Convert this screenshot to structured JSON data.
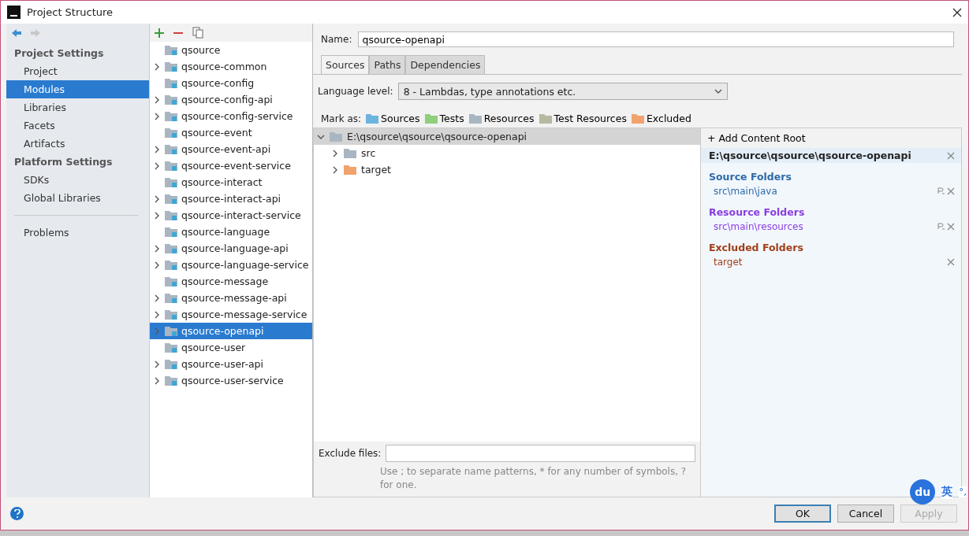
{
  "window": {
    "title": "Project Structure"
  },
  "nav": {
    "sections": [
      {
        "title": "Project Settings",
        "items": [
          {
            "label": "Project",
            "selected": false
          },
          {
            "label": "Modules",
            "selected": true
          },
          {
            "label": "Libraries",
            "selected": false
          },
          {
            "label": "Facets",
            "selected": false
          },
          {
            "label": "Artifacts",
            "selected": false
          }
        ]
      },
      {
        "title": "Platform Settings",
        "items": [
          {
            "label": "SDKs",
            "selected": false
          },
          {
            "label": "Global Libraries",
            "selected": false
          }
        ]
      }
    ],
    "extra": [
      {
        "label": "Problems",
        "selected": false
      }
    ]
  },
  "modules": [
    {
      "name": "qsource",
      "expandable": false,
      "selected": false
    },
    {
      "name": "qsource-common",
      "expandable": true,
      "selected": false
    },
    {
      "name": "qsource-config",
      "expandable": false,
      "selected": false
    },
    {
      "name": "qsource-config-api",
      "expandable": true,
      "selected": false
    },
    {
      "name": "qsource-config-service",
      "expandable": true,
      "selected": false
    },
    {
      "name": "qsource-event",
      "expandable": false,
      "selected": false
    },
    {
      "name": "qsource-event-api",
      "expandable": true,
      "selected": false
    },
    {
      "name": "qsource-event-service",
      "expandable": true,
      "selected": false
    },
    {
      "name": "qsource-interact",
      "expandable": false,
      "selected": false
    },
    {
      "name": "qsource-interact-api",
      "expandable": true,
      "selected": false
    },
    {
      "name": "qsource-interact-service",
      "expandable": true,
      "selected": false
    },
    {
      "name": "qsource-language",
      "expandable": false,
      "selected": false
    },
    {
      "name": "qsource-language-api",
      "expandable": true,
      "selected": false
    },
    {
      "name": "qsource-language-service",
      "expandable": true,
      "selected": false
    },
    {
      "name": "qsource-message",
      "expandable": false,
      "selected": false
    },
    {
      "name": "qsource-message-api",
      "expandable": true,
      "selected": false
    },
    {
      "name": "qsource-message-service",
      "expandable": true,
      "selected": false
    },
    {
      "name": "qsource-openapi",
      "expandable": true,
      "selected": true
    },
    {
      "name": "qsource-user",
      "expandable": false,
      "selected": false
    },
    {
      "name": "qsource-user-api",
      "expandable": true,
      "selected": false
    },
    {
      "name": "qsource-user-service",
      "expandable": true,
      "selected": false
    }
  ],
  "name_field": {
    "label": "Name:",
    "value": "qsource-openapi"
  },
  "tabs": [
    {
      "label": "Sources",
      "selected": true
    },
    {
      "label": "Paths",
      "selected": false
    },
    {
      "label": "Dependencies",
      "selected": false
    }
  ],
  "language_level": {
    "label": "Language level:",
    "value": "8 - Lambdas, type annotations etc."
  },
  "mark_as": {
    "label": "Mark as:",
    "options": [
      {
        "label": "Sources",
        "color": "#6cb4de"
      },
      {
        "label": "Tests",
        "color": "#8fcf7b"
      },
      {
        "label": "Resources",
        "color": "#a9b6c2"
      },
      {
        "label": "Test Resources",
        "color": "#b8b8a0"
      },
      {
        "label": "Excluded",
        "color": "#f0a36c"
      }
    ]
  },
  "tree": {
    "label": "E:\\qsource\\qsource\\qsource-openapi",
    "expanded": true,
    "children": [
      {
        "label": "src",
        "expanded": false,
        "color": "#a9b6c2"
      },
      {
        "label": "target",
        "expanded": false,
        "color": "#f0a36c"
      }
    ]
  },
  "exclude_files": {
    "label": "Exclude files:",
    "hint": "Use ; to separate name patterns, * for any number of symbols, ? for one."
  },
  "content_root": {
    "add_label": "+ Add Content Root",
    "path": "E:\\qsource\\qsource\\qsource-openapi",
    "groups": [
      {
        "title": "Source Folders",
        "color": "#2d6aa8",
        "folders": [
          {
            "path": "src\\main\\java",
            "properties": true
          }
        ]
      },
      {
        "title": "Resource Folders",
        "color": "#8a3ee0",
        "folders": [
          {
            "path": "src\\main\\resources",
            "properties": true
          }
        ]
      },
      {
        "title": "Excluded Folders",
        "color": "#a0401a",
        "folders": [
          {
            "path": "target",
            "properties": false
          }
        ]
      }
    ]
  },
  "buttons": [
    {
      "label": "OK",
      "disabled": false,
      "default": true
    },
    {
      "label": "Cancel",
      "disabled": false,
      "default": false
    },
    {
      "label": "Apply",
      "disabled": true,
      "default": false
    }
  ],
  "ime": {
    "logo": "du",
    "mode": "英",
    "punct": "°,"
  }
}
